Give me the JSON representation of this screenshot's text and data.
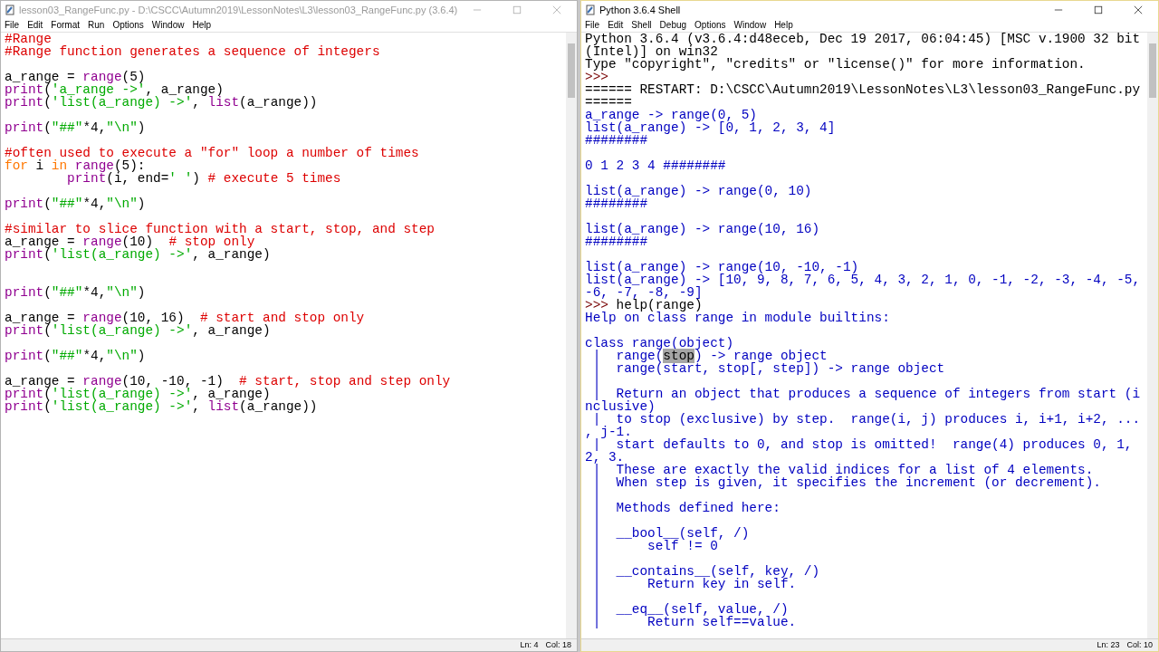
{
  "editor_window": {
    "title": "lesson03_RangeFunc.py - D:\\CSCC\\Autumn2019\\LessonNotes\\L3\\lesson03_RangeFunc.py (3.6.4)",
    "active": false,
    "menu": [
      "File",
      "Edit",
      "Format",
      "Run",
      "Options",
      "Window",
      "Help"
    ],
    "lines": [
      {
        "parts": [
          {
            "kind": "comment",
            "text": "#Range"
          }
        ]
      },
      {
        "parts": [
          {
            "kind": "comment",
            "text": "#Range function generates a sequence of integers"
          }
        ]
      },
      {
        "kind": "blank"
      },
      {
        "parts": [
          {
            "kind": "plain",
            "text": "a_range = "
          },
          {
            "kind": "builtin",
            "text": "range"
          },
          {
            "kind": "plain",
            "text": "(5)"
          }
        ]
      },
      {
        "parts": [
          {
            "kind": "builtin",
            "text": "print"
          },
          {
            "kind": "plain",
            "text": "("
          },
          {
            "kind": "string",
            "text": "'a_range ->'"
          },
          {
            "kind": "plain",
            "text": ", a_range)"
          }
        ]
      },
      {
        "parts": [
          {
            "kind": "builtin",
            "text": "print"
          },
          {
            "kind": "plain",
            "text": "("
          },
          {
            "kind": "string",
            "text": "'list(a_range) ->'"
          },
          {
            "kind": "plain",
            "text": ", "
          },
          {
            "kind": "builtin",
            "text": "list"
          },
          {
            "kind": "plain",
            "text": "(a_range))"
          }
        ]
      },
      {
        "kind": "blank"
      },
      {
        "parts": [
          {
            "kind": "builtin",
            "text": "print"
          },
          {
            "kind": "plain",
            "text": "("
          },
          {
            "kind": "string",
            "text": "\"##\""
          },
          {
            "kind": "plain",
            "text": "*4,"
          },
          {
            "kind": "string",
            "text": "\"\\n\""
          },
          {
            "kind": "plain",
            "text": ")"
          }
        ]
      },
      {
        "kind": "blank"
      },
      {
        "parts": [
          {
            "kind": "comment",
            "text": "#often used to execute a \"for\" loop a number of times"
          }
        ]
      },
      {
        "parts": [
          {
            "kind": "keyword",
            "text": "for"
          },
          {
            "kind": "plain",
            "text": " i "
          },
          {
            "kind": "keyword",
            "text": "in"
          },
          {
            "kind": "builtin",
            "text": " range"
          },
          {
            "kind": "plain",
            "text": "(5):"
          }
        ]
      },
      {
        "parts": [
          {
            "kind": "builtin",
            "text": "        print"
          },
          {
            "kind": "plain",
            "text": "(i, end="
          },
          {
            "kind": "string",
            "text": "' '"
          },
          {
            "kind": "plain",
            "text": ") "
          },
          {
            "kind": "comment",
            "text": "# execute 5 times"
          }
        ]
      },
      {
        "kind": "blank"
      },
      {
        "parts": [
          {
            "kind": "builtin",
            "text": "print"
          },
          {
            "kind": "plain",
            "text": "("
          },
          {
            "kind": "string",
            "text": "\"##\""
          },
          {
            "kind": "plain",
            "text": "*4,"
          },
          {
            "kind": "string",
            "text": "\"\\n\""
          },
          {
            "kind": "plain",
            "text": ")"
          }
        ]
      },
      {
        "kind": "blank"
      },
      {
        "parts": [
          {
            "kind": "comment",
            "text": "#similar to slice function with a start, stop, and step"
          }
        ]
      },
      {
        "parts": [
          {
            "kind": "plain",
            "text": "a_range = "
          },
          {
            "kind": "builtin",
            "text": "range"
          },
          {
            "kind": "plain",
            "text": "(10)  "
          },
          {
            "kind": "comment",
            "text": "# stop only"
          }
        ]
      },
      {
        "parts": [
          {
            "kind": "builtin",
            "text": "print"
          },
          {
            "kind": "plain",
            "text": "("
          },
          {
            "kind": "string",
            "text": "'list(a_range) ->'"
          },
          {
            "kind": "plain",
            "text": ", a_range)"
          }
        ]
      },
      {
        "kind": "blank"
      },
      {
        "kind": "blank"
      },
      {
        "parts": [
          {
            "kind": "builtin",
            "text": "print"
          },
          {
            "kind": "plain",
            "text": "("
          },
          {
            "kind": "string",
            "text": "\"##\""
          },
          {
            "kind": "plain",
            "text": "*4,"
          },
          {
            "kind": "string",
            "text": "\"\\n\""
          },
          {
            "kind": "plain",
            "text": ")"
          }
        ]
      },
      {
        "kind": "blank"
      },
      {
        "parts": [
          {
            "kind": "plain",
            "text": "a_range = "
          },
          {
            "kind": "builtin",
            "text": "range"
          },
          {
            "kind": "plain",
            "text": "(10, 16)  "
          },
          {
            "kind": "comment",
            "text": "# start and stop only"
          }
        ]
      },
      {
        "parts": [
          {
            "kind": "builtin",
            "text": "print"
          },
          {
            "kind": "plain",
            "text": "("
          },
          {
            "kind": "string",
            "text": "'list(a_range) ->'"
          },
          {
            "kind": "plain",
            "text": ", a_range)"
          }
        ]
      },
      {
        "kind": "blank"
      },
      {
        "parts": [
          {
            "kind": "builtin",
            "text": "print"
          },
          {
            "kind": "plain",
            "text": "("
          },
          {
            "kind": "string",
            "text": "\"##\""
          },
          {
            "kind": "plain",
            "text": "*4,"
          },
          {
            "kind": "string",
            "text": "\"\\n\""
          },
          {
            "kind": "plain",
            "text": ")"
          }
        ]
      },
      {
        "kind": "blank"
      },
      {
        "parts": [
          {
            "kind": "plain",
            "text": "a_range = "
          },
          {
            "kind": "builtin",
            "text": "range"
          },
          {
            "kind": "plain",
            "text": "(10, -10, -1)  "
          },
          {
            "kind": "comment",
            "text": "# start, stop and step only"
          }
        ]
      },
      {
        "parts": [
          {
            "kind": "builtin",
            "text": "print"
          },
          {
            "kind": "plain",
            "text": "("
          },
          {
            "kind": "string",
            "text": "'list(a_range) ->'"
          },
          {
            "kind": "plain",
            "text": ", a_range)"
          }
        ]
      },
      {
        "parts": [
          {
            "kind": "builtin",
            "text": "print"
          },
          {
            "kind": "plain",
            "text": "("
          },
          {
            "kind": "string",
            "text": "'list(a_range) ->'"
          },
          {
            "kind": "plain",
            "text": ", "
          },
          {
            "kind": "builtin",
            "text": "list"
          },
          {
            "kind": "plain",
            "text": "(a_range))"
          }
        ]
      }
    ],
    "status_bar": [
      "Ln: 4",
      "Col: 18"
    ]
  },
  "shell_window": {
    "title": "Python 3.6.4 Shell",
    "active": true,
    "menu": [
      "File",
      "Edit",
      "Shell",
      "Debug",
      "Options",
      "Window",
      "Help"
    ],
    "lines": [
      {
        "parts": [
          {
            "kind": "plain",
            "text": "Python 3.6.4 (v3.6.4:d48eceb, Dec 19 2017, 06:04:45) [MSC v.1900 32 bit"
          }
        ]
      },
      {
        "parts": [
          {
            "kind": "plain",
            "text": "(Intel)] on win32"
          }
        ]
      },
      {
        "parts": [
          {
            "kind": "plain",
            "text": "Type \"copyright\", \"credits\" or \"license()\" for more information."
          }
        ]
      },
      {
        "parts": [
          {
            "kind": "prompt",
            "text": ">>> "
          }
        ]
      },
      {
        "parts": [
          {
            "kind": "plain",
            "text": "====== RESTART: D:\\CSCC\\Autumn2019\\LessonNotes\\L3\\lesson03_RangeFunc.py"
          }
        ]
      },
      {
        "parts": [
          {
            "kind": "plain",
            "text": "======"
          }
        ]
      },
      {
        "parts": [
          {
            "kind": "output",
            "text": "a_range -> range(0, 5)"
          }
        ]
      },
      {
        "parts": [
          {
            "kind": "output",
            "text": "list(a_range) -> [0, 1, 2, 3, 4]"
          }
        ]
      },
      {
        "parts": [
          {
            "kind": "output",
            "text": "########"
          }
        ]
      },
      {
        "kind": "blank"
      },
      {
        "parts": [
          {
            "kind": "output",
            "text": "0 1 2 3 4 ########"
          }
        ]
      },
      {
        "kind": "blank"
      },
      {
        "parts": [
          {
            "kind": "output",
            "text": "list(a_range) -> range(0, 10)"
          }
        ]
      },
      {
        "parts": [
          {
            "kind": "output",
            "text": "########"
          }
        ]
      },
      {
        "kind": "blank"
      },
      {
        "parts": [
          {
            "kind": "output",
            "text": "list(a_range) -> range(10, 16)"
          }
        ]
      },
      {
        "parts": [
          {
            "kind": "output",
            "text": "########"
          }
        ]
      },
      {
        "kind": "blank"
      },
      {
        "parts": [
          {
            "kind": "output",
            "text": "list(a_range) -> range(10, -10, -1)"
          }
        ]
      },
      {
        "parts": [
          {
            "kind": "output",
            "text": "list(a_range) -> [10, 9, 8, 7, 6, 5, 4, 3, 2, 1, 0, -1, -2, -3, -4, -5,"
          }
        ]
      },
      {
        "parts": [
          {
            "kind": "output",
            "text": "-6, -7, -8, -9]"
          }
        ]
      },
      {
        "parts": [
          {
            "kind": "prompt",
            "text": ">>> "
          },
          {
            "kind": "plain",
            "text": "help(range)"
          }
        ]
      },
      {
        "parts": [
          {
            "kind": "output",
            "text": "Help on class range in module builtins:"
          }
        ]
      },
      {
        "kind": "blank"
      },
      {
        "parts": [
          {
            "kind": "output",
            "text": "class range(object)"
          }
        ]
      },
      {
        "parts": [
          {
            "kind": "output",
            "text": " |  range("
          },
          {
            "kind": "selected",
            "text": "stop"
          },
          {
            "kind": "output",
            "text": ") -> range object"
          }
        ]
      },
      {
        "parts": [
          {
            "kind": "output",
            "text": " |  range(start, stop[, step]) -> range object"
          }
        ]
      },
      {
        "parts": [
          {
            "kind": "output",
            "text": " |"
          }
        ]
      },
      {
        "parts": [
          {
            "kind": "output",
            "text": " |  Return an object that produces a sequence of integers from start (i"
          }
        ]
      },
      {
        "parts": [
          {
            "kind": "output",
            "text": "nclusive)"
          }
        ]
      },
      {
        "parts": [
          {
            "kind": "output",
            "text": " |  to stop (exclusive) by step.  range(i, j) produces i, i+1, i+2, ..."
          }
        ]
      },
      {
        "parts": [
          {
            "kind": "output",
            "text": ", j-1."
          }
        ]
      },
      {
        "parts": [
          {
            "kind": "output",
            "text": " |  start defaults to 0, and stop is omitted!  range(4) produces 0, 1,"
          }
        ]
      },
      {
        "parts": [
          {
            "kind": "output",
            "text": "2, 3."
          }
        ]
      },
      {
        "parts": [
          {
            "kind": "output",
            "text": " |  These are exactly the valid indices for a list of 4 elements."
          }
        ]
      },
      {
        "parts": [
          {
            "kind": "output",
            "text": " |  When step is given, it specifies the increment (or decrement)."
          }
        ]
      },
      {
        "parts": [
          {
            "kind": "output",
            "text": " |"
          }
        ]
      },
      {
        "parts": [
          {
            "kind": "output",
            "text": " |  Methods defined here:"
          }
        ]
      },
      {
        "parts": [
          {
            "kind": "output",
            "text": " |"
          }
        ]
      },
      {
        "parts": [
          {
            "kind": "output",
            "text": " |  __bool__(self, /)"
          }
        ]
      },
      {
        "parts": [
          {
            "kind": "output",
            "text": " |      self != 0"
          }
        ]
      },
      {
        "parts": [
          {
            "kind": "output",
            "text": " |"
          }
        ]
      },
      {
        "parts": [
          {
            "kind": "output",
            "text": " |  __contains__(self, key, /)"
          }
        ]
      },
      {
        "parts": [
          {
            "kind": "output",
            "text": " |      Return key in self."
          }
        ]
      },
      {
        "parts": [
          {
            "kind": "output",
            "text": " |"
          }
        ]
      },
      {
        "parts": [
          {
            "kind": "output",
            "text": " |  __eq__(self, value, /)"
          }
        ]
      },
      {
        "parts": [
          {
            "kind": "output",
            "text": " |      Return self==value."
          }
        ]
      }
    ],
    "status_bar": [
      "Ln: 23",
      "Col: 10"
    ]
  }
}
